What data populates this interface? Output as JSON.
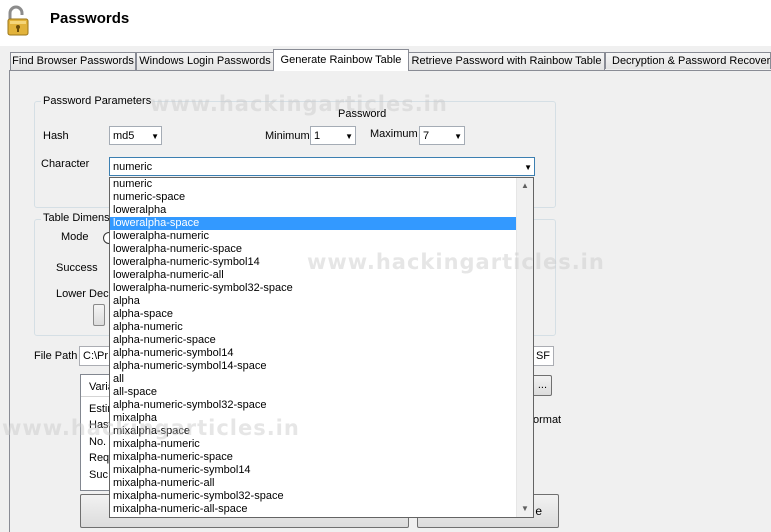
{
  "app": {
    "title": "Passwords",
    "icon": "open-padlock-icon"
  },
  "tabs": [
    {
      "label": "Find Browser Passwords"
    },
    {
      "label": "Windows Login Passwords"
    },
    {
      "label": "Generate Rainbow Table"
    },
    {
      "label": "Retrieve Password with Rainbow Table"
    },
    {
      "label": "Decryption & Password Recovery"
    }
  ],
  "params": {
    "group_title": "Password Parameters",
    "hash_label": "Hash",
    "hash_value": "md5",
    "password_label": "Password",
    "minimum_label": "Minimum",
    "minimum_value": "1",
    "maximum_label": "Maximum",
    "maximum_value": "7",
    "character_label": "Character",
    "character_value": "numeric"
  },
  "table": {
    "group_title_partial": "Table Dimens",
    "mode_label": "Mode",
    "success_label": "Success",
    "lower_dec_label": "Lower Dec"
  },
  "file": {
    "path_label": "File Path",
    "path_value_start": "C:\\Pr",
    "path_value_end": "SF",
    "browse_label": "..."
  },
  "info": {
    "header_partial": "Varia",
    "rows_partial": [
      "Estir",
      "Hast",
      "No.",
      "Req",
      "Suc"
    ],
    "format_partial": "ormat"
  },
  "bottom": {
    "right_button_partial": "e"
  },
  "dropdown": {
    "selected_index": 3,
    "options": [
      "numeric",
      "numeric-space",
      "loweralpha",
      "loweralpha-space",
      "loweralpha-numeric",
      "loweralpha-numeric-space",
      "loweralpha-numeric-symbol14",
      "loweralpha-numeric-all",
      "loweralpha-numeric-symbol32-space",
      "alpha",
      "alpha-space",
      "alpha-numeric",
      "alpha-numeric-space",
      "alpha-numeric-symbol14",
      "alpha-numeric-symbol14-space",
      "all",
      "all-space",
      "alpha-numeric-symbol32-space",
      "mixalpha",
      "mixalpha-space",
      "mixalpha-numeric",
      "mixalpha-numeric-space",
      "mixalpha-numeric-symbol14",
      "mixalpha-numeric-all",
      "mixalpha-numeric-symbol32-space",
      "mixalpha-numeric-all-space"
    ]
  },
  "watermarks": [
    "www.hackingarticles.in",
    "www.hackingarticles.in",
    "www.hackingarticles.in"
  ],
  "colors": {
    "selection": "#3399ff",
    "panel": "#f0f0f0"
  }
}
